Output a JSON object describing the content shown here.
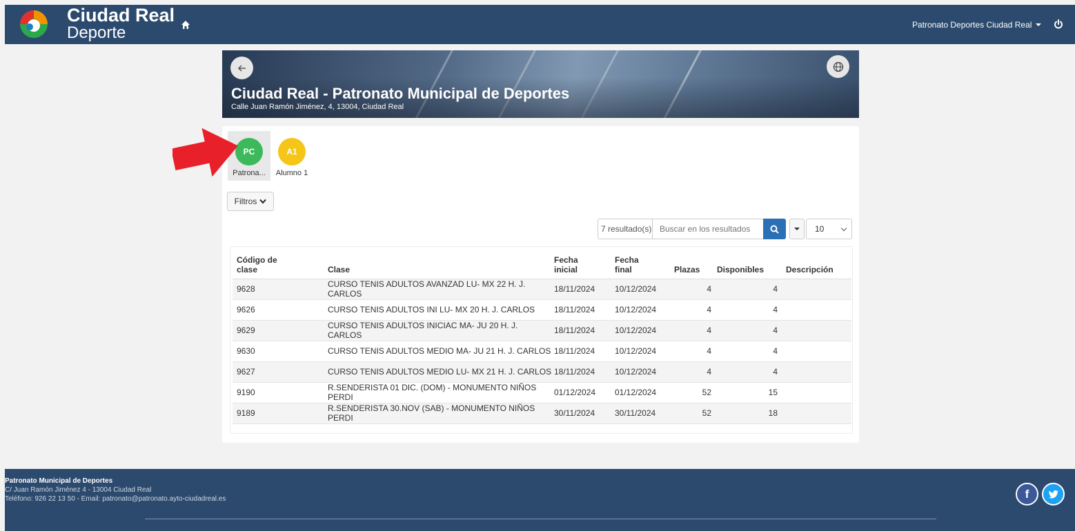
{
  "header": {
    "brand_title": "Ciudad Real",
    "brand_sub": "Deporte",
    "user_label": "Patronato Deportes Ciudad Real",
    "icons": [
      "home-icon",
      "power-icon"
    ]
  },
  "hero": {
    "title": "Ciudad Real - Patronato Municipal de Deportes",
    "address": "Calle Juan Ramón Jiménez, 4, 13004, Ciudad Real"
  },
  "profiles": [
    {
      "initials": "PC",
      "label": "Patrona...",
      "color": "#3cb95a",
      "selected": true
    },
    {
      "initials": "A1",
      "label": "Alumno 1",
      "color": "#f5c518",
      "selected": false
    }
  ],
  "toolbar": {
    "filters_label": "Filtros",
    "results_label": "7 resultado(s)",
    "search_placeholder": "Buscar en los resultados",
    "page_size": "10"
  },
  "table": {
    "headers": [
      "Código de clase",
      "Clase",
      "Fecha inicial",
      "Fecha final",
      "Plazas",
      "Disponibles",
      "Descripción"
    ],
    "rows": [
      {
        "codigo": "9628",
        "clase": "CURSO TENIS ADULTOS AVANZAD LU- MX 22 H. J. CARLOS",
        "inicio": "18/11/2024",
        "fin": "10/12/2024",
        "plazas": "4",
        "disponibles": "4",
        "descripcion": ""
      },
      {
        "codigo": "9626",
        "clase": "CURSO TENIS ADULTOS INI LU- MX 20 H. J. CARLOS",
        "inicio": "18/11/2024",
        "fin": "10/12/2024",
        "plazas": "4",
        "disponibles": "4",
        "descripcion": ""
      },
      {
        "codigo": "9629",
        "clase": "CURSO TENIS ADULTOS INICIAC MA- JU 20 H. J. CARLOS",
        "inicio": "18/11/2024",
        "fin": "10/12/2024",
        "plazas": "4",
        "disponibles": "4",
        "descripcion": ""
      },
      {
        "codigo": "9630",
        "clase": "CURSO TENIS ADULTOS MEDIO MA- JU 21 H. J. CARLOS",
        "inicio": "18/11/2024",
        "fin": "10/12/2024",
        "plazas": "4",
        "disponibles": "4",
        "descripcion": ""
      },
      {
        "codigo": "9627",
        "clase": "CURSO TENIS ADULTOS MEDIO LU- MX 21 H. J. CARLOS",
        "inicio": "18/11/2024",
        "fin": "10/12/2024",
        "plazas": "4",
        "disponibles": "4",
        "descripcion": ""
      },
      {
        "codigo": "9190",
        "clase": "R.SENDERISTA 01 DIC. (DOM) - MONUMENTO NIÑOS PERDI",
        "inicio": "01/12/2024",
        "fin": "01/12/2024",
        "plazas": "52",
        "disponibles": "15",
        "descripcion": ""
      },
      {
        "codigo": "9189",
        "clase": "R.SENDERISTA 30.NOV (SAB) - MONUMENTO NIÑOS PERDI",
        "inicio": "30/11/2024",
        "fin": "30/11/2024",
        "plazas": "52",
        "disponibles": "18",
        "descripcion": ""
      }
    ]
  },
  "footer": {
    "title": "Patronato Municipal de Deportes",
    "address": "C/ Juan Ramón Jiménez 4 - 13004 Ciudad Real",
    "contact": "Teléfono: 926 22 13 50 - Email: patronato@patronato.ayto-ciudadreal.es",
    "social": [
      "facebook-icon",
      "twitter-icon"
    ]
  },
  "colors": {
    "nav_bg": "#2c4a6e",
    "accent": "#2b6fb5",
    "annotation_arrow": "#e8202a"
  }
}
